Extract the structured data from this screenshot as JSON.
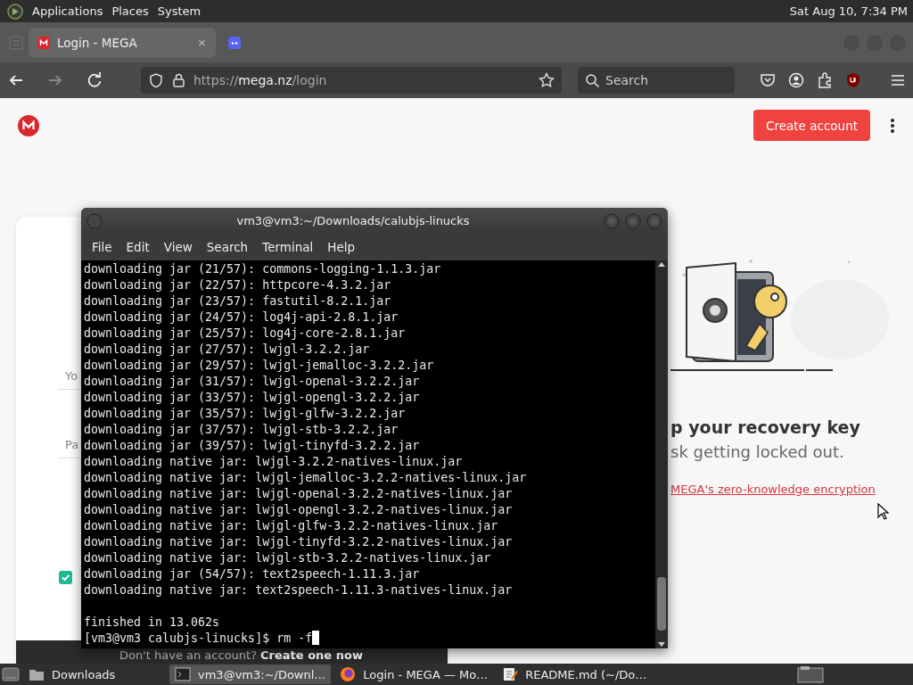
{
  "top_panel": {
    "menus": [
      "Applications",
      "Places",
      "System"
    ],
    "clock": "Sat Aug 10, 7:34 PM"
  },
  "browser": {
    "tabs": [
      {
        "label": "Login - MEGA",
        "close": "×",
        "kind": "mega",
        "selected": true
      },
      {
        "kind": "chat",
        "selected": false
      }
    ],
    "address": {
      "scheme": "https://",
      "host": "mega.nz",
      "path": "/login"
    },
    "search": {
      "placeholder": "Search"
    }
  },
  "page": {
    "create_button": "Create account",
    "login_form": {
      "fields": [
        {
          "placeholder": "Yo"
        },
        {
          "placeholder": "Pa"
        }
      ],
      "remember": {
        "checked": true
      },
      "footer_text": "Don't have an account?",
      "footer_link": "Create one now"
    },
    "promo": {
      "heading": "p your recovery key",
      "text": "sk getting locked out.",
      "link": "MEGA's zero-knowledge encryption"
    }
  },
  "terminal": {
    "title": "vm3@vm3:~/Downloads/calubjs-linucks",
    "menus": [
      "File",
      "Edit",
      "View",
      "Search",
      "Terminal",
      "Help"
    ],
    "lines": [
      "downloading jar (21/57): commons-logging-1.1.3.jar",
      "downloading jar (22/57): httpcore-4.3.2.jar",
      "downloading jar (23/57): fastutil-8.2.1.jar",
      "downloading jar (24/57): log4j-api-2.8.1.jar",
      "downloading jar (25/57): log4j-core-2.8.1.jar",
      "downloading jar (27/57): lwjgl-3.2.2.jar",
      "downloading jar (29/57): lwjgl-jemalloc-3.2.2.jar",
      "downloading jar (31/57): lwjgl-openal-3.2.2.jar",
      "downloading jar (33/57): lwjgl-opengl-3.2.2.jar",
      "downloading jar (35/57): lwjgl-glfw-3.2.2.jar",
      "downloading jar (37/57): lwjgl-stb-3.2.2.jar",
      "downloading jar (39/57): lwjgl-tinyfd-3.2.2.jar",
      "downloading native jar: lwjgl-3.2.2-natives-linux.jar",
      "downloading native jar: lwjgl-jemalloc-3.2.2-natives-linux.jar",
      "downloading native jar: lwjgl-openal-3.2.2-natives-linux.jar",
      "downloading native jar: lwjgl-opengl-3.2.2-natives-linux.jar",
      "downloading native jar: lwjgl-glfw-3.2.2-natives-linux.jar",
      "downloading native jar: lwjgl-tinyfd-3.2.2-natives-linux.jar",
      "downloading native jar: lwjgl-stb-3.2.2-natives-linux.jar",
      "downloading jar (54/57): text2speech-1.11.3.jar",
      "downloading native jar: text2speech-1.11.3-natives-linux.jar"
    ],
    "summary": "finished in 13.062s",
    "prompt": "[vm3@vm3 calubjs-linucks]$ rm -f"
  },
  "taskbar": {
    "items": [
      {
        "label": "Downloads",
        "kind": "folder",
        "selected": false
      },
      {
        "label": "vm3@vm3:~/Downl…",
        "kind": "terminal",
        "selected": true
      },
      {
        "label": "Login - MEGA — Mo…",
        "kind": "browser",
        "selected": false
      },
      {
        "label": "README.md (~/Do…",
        "kind": "editor",
        "selected": false
      }
    ]
  }
}
